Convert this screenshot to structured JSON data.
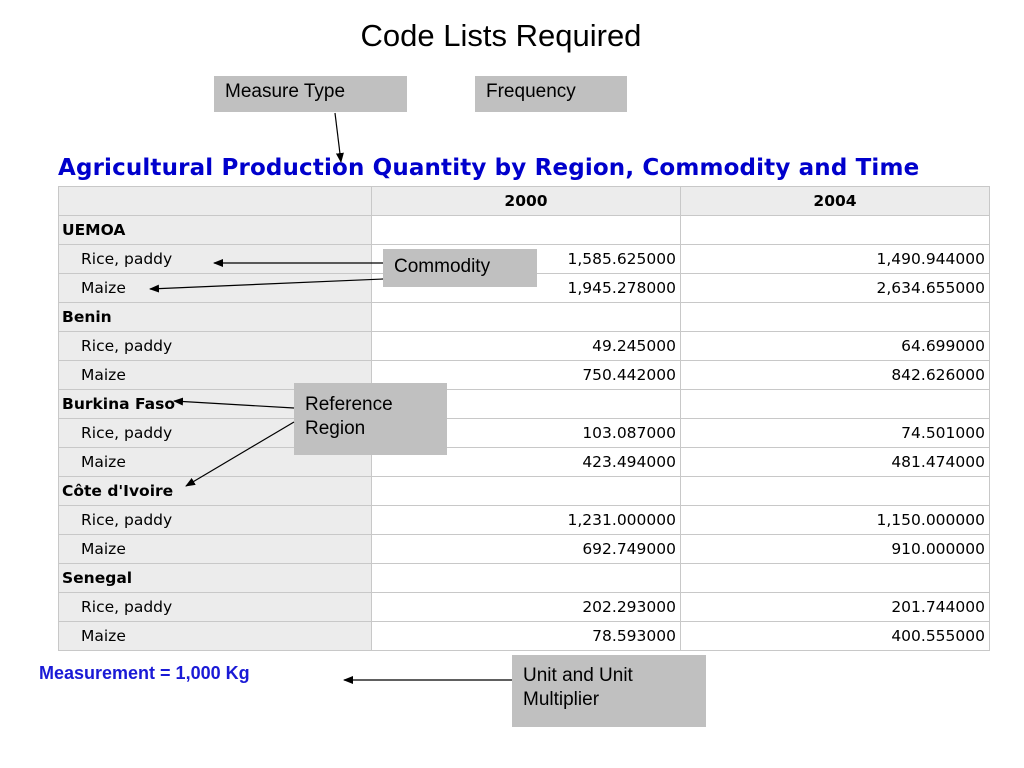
{
  "slide": {
    "title": "Code Lists Required"
  },
  "callouts": {
    "measure_type": "Measure Type",
    "frequency": "Frequency",
    "commodity": "Commodity",
    "reference_region_line1": "Reference",
    "reference_region_line2": "Region",
    "unit_line1": "Unit and Unit",
    "unit_line2": "Multiplier"
  },
  "table": {
    "title": "Agricultural Production Quantity by Region, Commodity and Time",
    "columns": [
      "",
      "2000",
      "2004"
    ],
    "rows": [
      {
        "type": "region",
        "label": "UEMOA"
      },
      {
        "type": "commodity",
        "label": "Rice, paddy",
        "v2000": "1,585.625000",
        "v2004": "1,490.944000"
      },
      {
        "type": "commodity",
        "label": "Maize",
        "v2000": "1,945.278000",
        "v2004": "2,634.655000"
      },
      {
        "type": "region",
        "label": "Benin"
      },
      {
        "type": "commodity",
        "label": "Rice, paddy",
        "v2000": "49.245000",
        "v2004": "64.699000"
      },
      {
        "type": "commodity",
        "label": "Maize",
        "v2000": "750.442000",
        "v2004": "842.626000"
      },
      {
        "type": "region",
        "label": "Burkina Faso"
      },
      {
        "type": "commodity",
        "label": "Rice, paddy",
        "v2000": "103.087000",
        "v2004": "74.501000"
      },
      {
        "type": "commodity",
        "label": "Maize",
        "v2000": "423.494000",
        "v2004": "481.474000"
      },
      {
        "type": "region",
        "label": "Côte d'Ivoire"
      },
      {
        "type": "commodity",
        "label": "Rice, paddy",
        "v2000": "1,231.000000",
        "v2004": "1,150.000000"
      },
      {
        "type": "commodity",
        "label": "Maize",
        "v2000": "692.749000",
        "v2004": "910.000000"
      },
      {
        "type": "region",
        "label": "Senegal"
      },
      {
        "type": "commodity",
        "label": "Rice, paddy",
        "v2000": "202.293000",
        "v2004": "201.744000"
      },
      {
        "type": "commodity",
        "label": "Maize",
        "v2000": "78.593000",
        "v2004": "400.555000"
      }
    ]
  },
  "footer": {
    "measurement": "Measurement = 1,000 Kg"
  },
  "colors": {
    "title_blue": "#0000cc",
    "measurement_blue": "#1a1ad6",
    "callout_gray": "#c0c0c0"
  }
}
